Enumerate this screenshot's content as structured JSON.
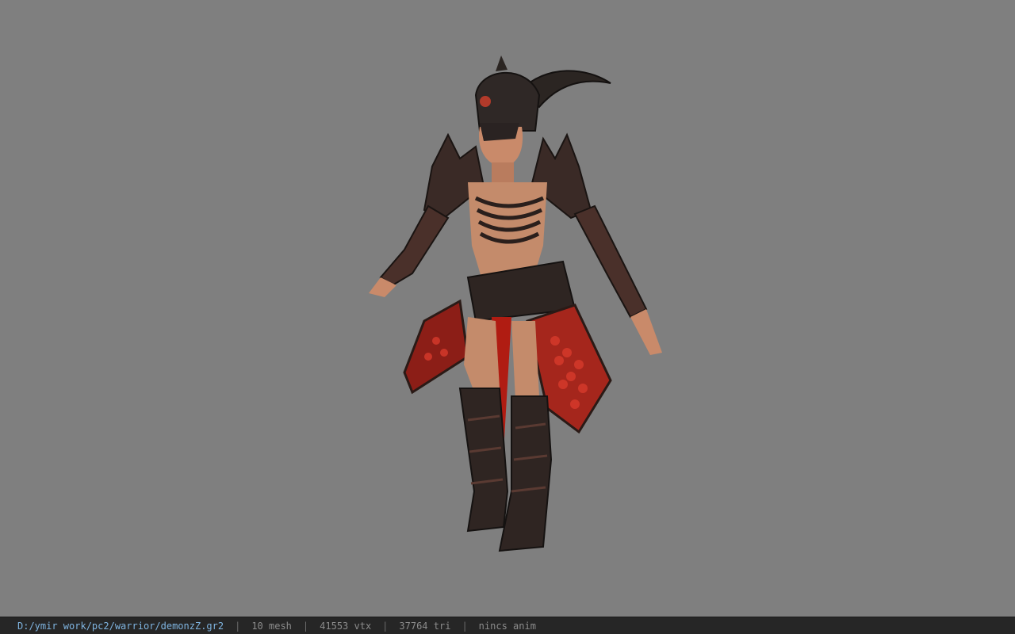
{
  "viewport": {
    "background_color": "#7f7f7f",
    "subject": "warrior-model"
  },
  "statusbar": {
    "file_path": "D:/ymir work/pc2/warrior/demonzZ.gr2",
    "separator": "|",
    "mesh": "10 mesh",
    "vertices": "41553 vtx",
    "triangles": "37764 tri",
    "animation": "nincs anim"
  }
}
